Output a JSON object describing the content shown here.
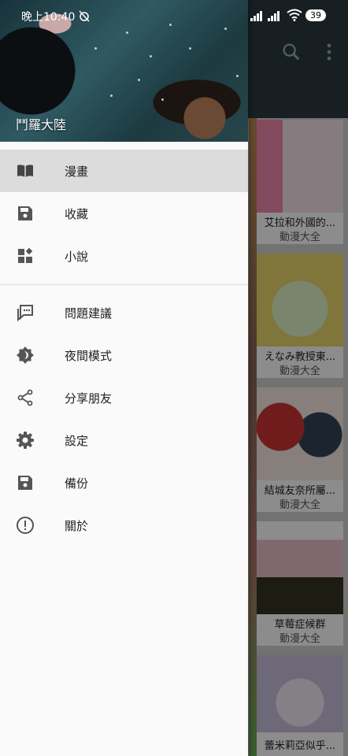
{
  "status_bar": {
    "time": "晚上10:40",
    "battery": "39"
  },
  "toolbar_icons": [
    "search-icon",
    "more-vert-icon"
  ],
  "background_grid": [
    {
      "title": "艾拉和外國的...",
      "category": "動漫大全"
    },
    {
      "title": "えなみ教授東...",
      "category": "動漫大全"
    },
    {
      "title": "結城友奈所屬...",
      "category": "動漫大全"
    },
    {
      "title": "草莓症候群",
      "category": "動漫大全"
    },
    {
      "title": "蕾米莉亞似乎...",
      "category": ""
    }
  ],
  "drawer": {
    "header_title": "鬥羅大陸",
    "menu_group_1": [
      {
        "label": "漫畫",
        "icon": "book-icon",
        "active": true
      },
      {
        "label": "收藏",
        "icon": "save-icon"
      },
      {
        "label": "小說",
        "icon": "dashboard-icon"
      }
    ],
    "menu_group_2": [
      {
        "label": "問題建議",
        "icon": "feedback-icon"
      },
      {
        "label": "夜間模式",
        "icon": "brightness-icon"
      },
      {
        "label": "分享朋友",
        "icon": "share-icon"
      },
      {
        "label": "設定",
        "icon": "settings-icon"
      },
      {
        "label": "備份",
        "icon": "backup-icon"
      },
      {
        "label": "關於",
        "icon": "info-icon"
      }
    ]
  },
  "colors": {
    "icon": "#555555",
    "active_bg": "#dcdcdc",
    "toolbar": "#2b3a40"
  }
}
